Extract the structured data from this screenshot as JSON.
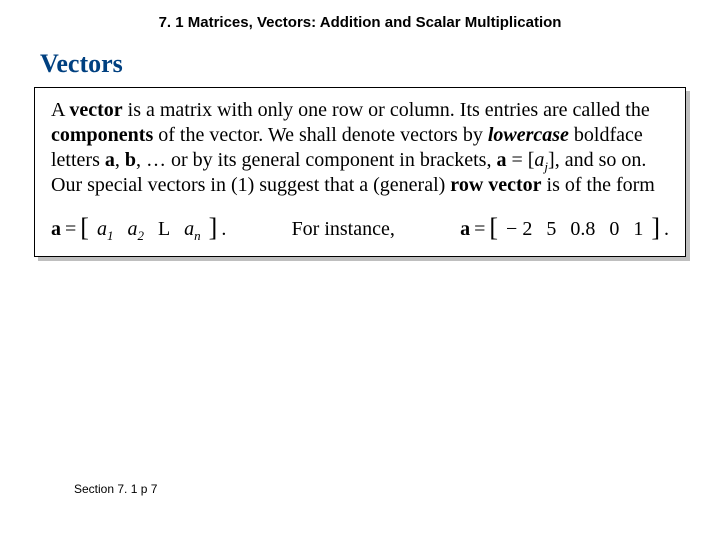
{
  "header": "7. 1 Matrices, Vectors:  Addition and Scalar Multiplication",
  "subtitle": "Vectors",
  "body": {
    "t1": "A ",
    "b1": "vector",
    "t2": " is a matrix with only one row or column. Its entries are called the ",
    "b2": "components",
    "t3": " of the vector. We shall denote vectors by ",
    "bi1": "lowercase",
    "t4": " boldface letters ",
    "b3": "a",
    "t5": ", ",
    "b4": "b",
    "t6": ", … or by its general component in brackets, ",
    "b5": "a",
    "t7": " = [",
    "i1": "a",
    "sub1": "j",
    "t8": "], and so on. Our special vectors in (1) suggest that a (general) ",
    "b6": "row vector",
    "t9": " is of the form"
  },
  "math": {
    "lhs_var": "a",
    "eq": " = ",
    "lb": "[",
    "rb": "]",
    "a": "a",
    "s1": "1",
    "s2": "2",
    "L": "L",
    "sn": "n",
    "period": ".",
    "mid": "For instance,",
    "rhs_var": "a",
    "v1": "− 2",
    "v2": "5",
    "v3": "0.8",
    "v4": "0",
    "v5": "1"
  },
  "footer": "Section 7. 1  p 7"
}
